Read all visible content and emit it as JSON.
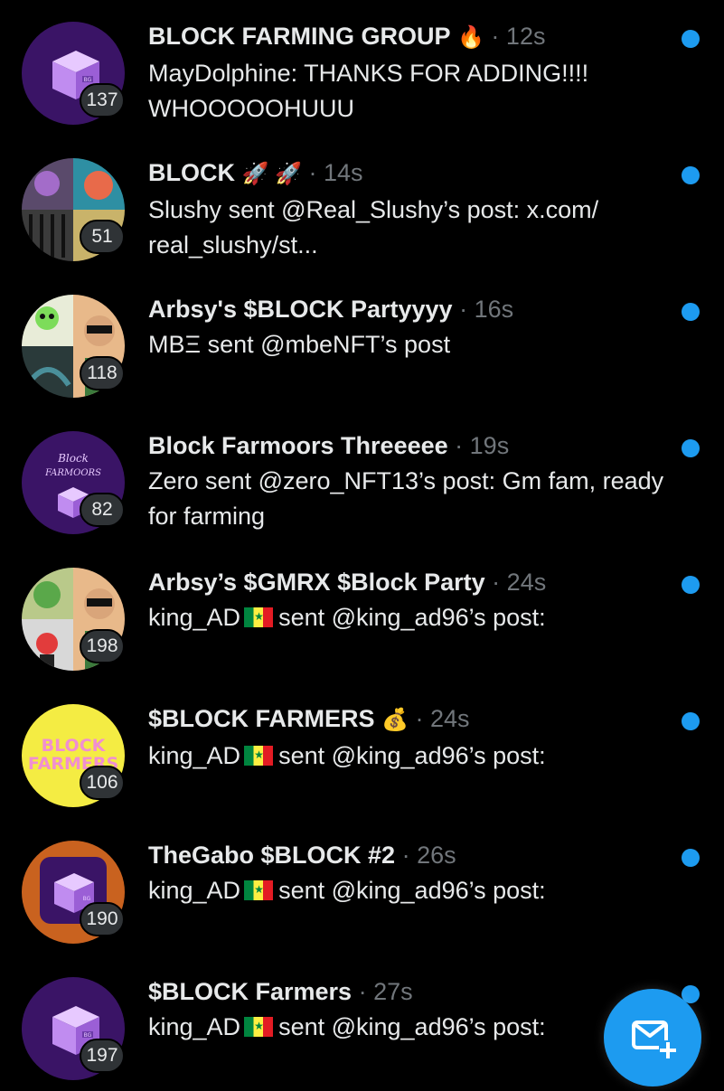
{
  "conversations": [
    {
      "title": "BLOCK FARMING GROUP",
      "emoji": "🔥",
      "time": "12s",
      "sender": "MayDolphine:",
      "preview": "THANKS FOR ADDING!!!! WHOOOOOHUUU",
      "flag": false,
      "count": "137",
      "avatar": "cube-purple-avatar"
    },
    {
      "title": "BLOCK",
      "emoji": "🚀 🚀",
      "time": "14s",
      "sender": "Slushy",
      "preview": "sent @Real_Slushy’s post: x.com/ real_slushy/st...",
      "flag": false,
      "count": "51",
      "avatar": "nft-collage-avatar"
    },
    {
      "title": "Arbsy's $BLOCK Partyyyy",
      "emoji": "",
      "time": "16s",
      "sender": "MBΞ",
      "preview": "sent @mbeNFT’s post",
      "flag": false,
      "count": "118",
      "avatar": "nft-collage-avatar"
    },
    {
      "title": "Block Farmoors Threeeee",
      "emoji": "",
      "time": "19s",
      "sender": "Zero",
      "preview": "sent @zero_NFT13’s post: Gm fam, ready for farming",
      "flag": false,
      "count": "82",
      "avatar": "block-farmoors-avatar"
    },
    {
      "title": "Arbsy’s $GMRX  $Block Party",
      "emoji": "",
      "time": "24s",
      "sender": "king_AD",
      "preview": "sent @king_ad96’s post:",
      "flag": true,
      "count": "198",
      "avatar": "nft-collage-avatar"
    },
    {
      "title": "$BLOCK FARMERS",
      "emoji": "💰",
      "time": "24s",
      "sender": "king_AD",
      "preview": "sent @king_ad96’s post:",
      "flag": true,
      "count": "106",
      "avatar": "block-farmers-yellow-avatar"
    },
    {
      "title": "TheGabo $BLOCK #2",
      "emoji": "",
      "time": "26s",
      "sender": "king_AD",
      "preview": "sent @king_ad96’s post:",
      "flag": true,
      "count": "190",
      "avatar": "cube-orange-avatar"
    },
    {
      "title": "$BLOCK Farmers",
      "emoji": "",
      "time": "27s",
      "sender": "king_AD",
      "preview": "sent @king_ad96’s post:",
      "flag": true,
      "count": "197",
      "avatar": "cube-purple-avatar"
    }
  ],
  "avatar_text": {
    "block_farmoors": [
      "Block",
      "FARMOORS"
    ],
    "block_farmers": [
      "BLOCK",
      "FARMERS"
    ],
    "cube_label": "BG"
  },
  "fab": {
    "icon": "new-message-icon"
  },
  "colors": {
    "background": "#000000",
    "primary_text": "#e7e9ea",
    "secondary_text": "#71767b",
    "accent": "#1d9bf0",
    "badge": "#2f3336"
  }
}
